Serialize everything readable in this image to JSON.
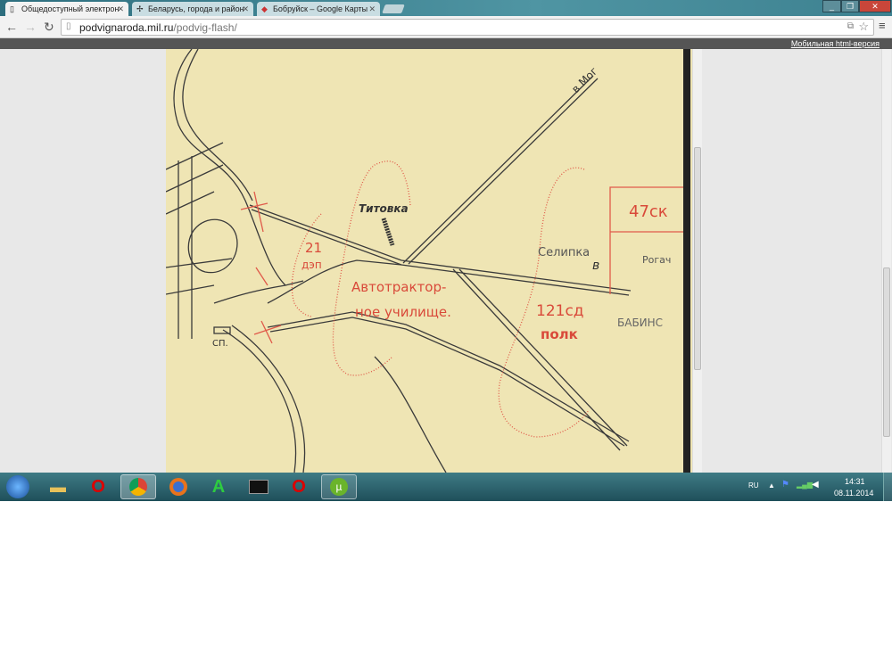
{
  "browser": {
    "tabs": [
      {
        "title": "Общедоступный электрон",
        "icon": "page-icon",
        "active": true
      },
      {
        "title": "Беларусь, города и район",
        "icon": "cross-icon",
        "active": false
      },
      {
        "title": "Бобруйск – Google Карты",
        "icon": "google-maps-icon",
        "active": false
      }
    ],
    "url_host": "podvignaroda.mil.ru",
    "url_path": "/podvig-flash/",
    "mobile_link": "Мобильная html-версия"
  },
  "map": {
    "labels": {
      "to_mogilev": "в Мог",
      "titovka": "Титовка",
      "dep_21": "21",
      "dep_21b": "дэп",
      "school1": "Автотрактор-",
      "school2": "ное училище.",
      "selipka": "Селипка",
      "v": "в",
      "rogach": "Рогач",
      "ck47": "47ск",
      "sd121": "121сд",
      "polk": "полк",
      "babin": "БАБИНС",
      "sp": "СП."
    }
  },
  "taskbar": {
    "apps": [
      "explorer",
      "opera",
      "chrome",
      "firefox",
      "green-a",
      "monitor",
      "opera",
      "utorrent"
    ],
    "lang": "RU",
    "time": "14:31",
    "date": "08.11.2014"
  }
}
